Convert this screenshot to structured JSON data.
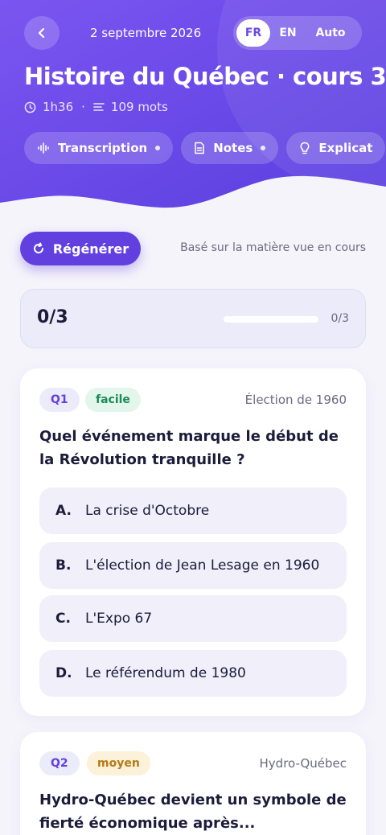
{
  "header": {
    "date": "2 septembre 2026",
    "languages": [
      "FR",
      "EN",
      "Auto"
    ],
    "active_language": "FR",
    "title": "Histoire du Québec · cours 3",
    "duration": "1h36",
    "word_count": "109 mots",
    "chips": [
      {
        "label": "Transcription",
        "icon": "waveform-icon"
      },
      {
        "label": "Notes",
        "icon": "document-icon"
      },
      {
        "label": "Explicat",
        "icon": "lightbulb-icon"
      }
    ]
  },
  "actions": {
    "regenerate_label": "Régénérer",
    "based_on": "Basé sur la matière vue en cours"
  },
  "progress": {
    "score": "0/3",
    "label": "0/3",
    "fraction": 0
  },
  "questions": [
    {
      "number": "Q1",
      "difficulty": "facile",
      "topic": "Élection de 1960",
      "text": "Quel événement marque le début de la Révolution tranquille ?",
      "options": [
        {
          "letter": "A.",
          "text": "La crise d'Octobre"
        },
        {
          "letter": "B.",
          "text": "L'élection de Jean Lesage en 1960"
        },
        {
          "letter": "C.",
          "text": "L'Expo 67"
        },
        {
          "letter": "D.",
          "text": "Le référendum de 1980"
        }
      ]
    },
    {
      "number": "Q2",
      "difficulty": "moyen",
      "topic": "Hydro-Québec",
      "text": "Hydro-Québec devient un symbole de fierté économique après..."
    }
  ],
  "colors": {
    "primary": "#6240e0",
    "header_gradient_start": "#7b55f0",
    "header_gradient_end": "#5a3fe0",
    "easy_badge": "#1f8a58",
    "medium_badge": "#b47a16"
  }
}
